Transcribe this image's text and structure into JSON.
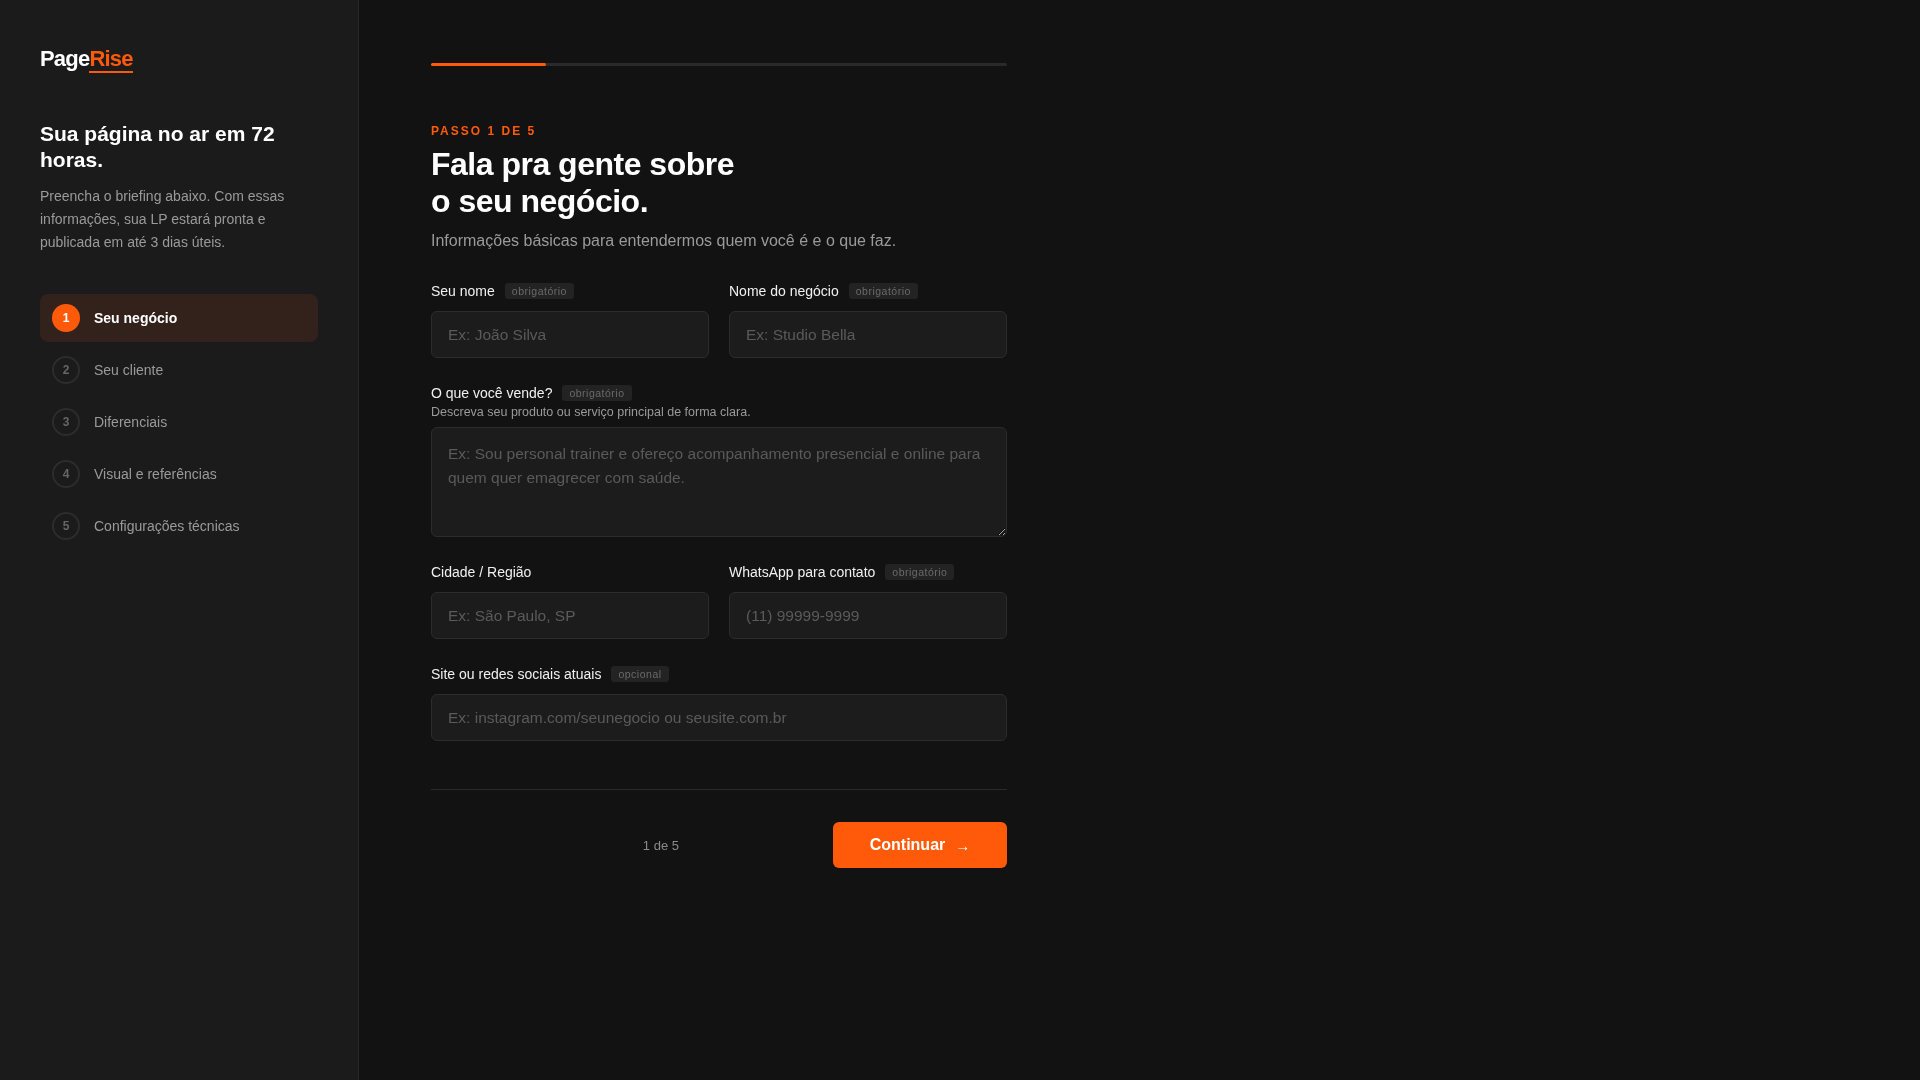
{
  "sidebar": {
    "logo": {
      "first": "Page",
      "second": "Rise"
    },
    "heading": "Sua página no ar em 72 horas.",
    "description": "Preencha o briefing abaixo. Com essas informações, sua LP estará pronta e publicada em até 3 dias úteis.",
    "steps": [
      {
        "number": "1",
        "label": "Seu negócio",
        "selected": true
      },
      {
        "number": "2",
        "label": "Seu cliente",
        "selected": false
      },
      {
        "number": "3",
        "label": "Diferenciais",
        "selected": false
      },
      {
        "number": "4",
        "label": "Visual e referências",
        "selected": false
      },
      {
        "number": "5",
        "label": "Configurações técnicas",
        "selected": false
      }
    ]
  },
  "progress": {
    "level": 0.2
  },
  "form": {
    "eyebrow": "PASSO 1 DE 5",
    "title_lines": [
      "Fala pra gente sobre",
      "o seu negócio."
    ],
    "subtitle": "Informações básicas para entendermos quem você é e o que faz.",
    "rows": [
      [
        {
          "kind": "input",
          "label": "Seu nome",
          "tag": "obrigatório",
          "placeholder": "Ex: João Silva"
        },
        {
          "kind": "input",
          "label": "Nome do negócio",
          "tag": "obrigatório",
          "placeholder": "Ex: Studio Bella"
        }
      ],
      [
        {
          "kind": "textarea",
          "label": "O que você vende?",
          "tag": "obrigatório",
          "hint": "Descreva seu produto ou serviço principal de forma clara.",
          "placeholder": "Ex: Sou personal trainer e ofereço acompanhamento presencial e online para quem quer emagrecer com saúde."
        }
      ],
      [
        {
          "kind": "input",
          "label": "Cidade / Região",
          "placeholder": "Ex: São Paulo, SP"
        },
        {
          "kind": "input",
          "label": "WhatsApp para contato",
          "tag": "obrigatório",
          "placeholder": "(11) 99999-9999"
        }
      ],
      [
        {
          "kind": "input",
          "label": "Site ou redes sociais atuais",
          "tag": "opcional",
          "placeholder": "Ex: instagram.com/seunegocio ou seusite.com.br"
        }
      ]
    ]
  },
  "footer": {
    "counter": "1 de 5",
    "button": "Continuar",
    "button_arrow": "→"
  }
}
